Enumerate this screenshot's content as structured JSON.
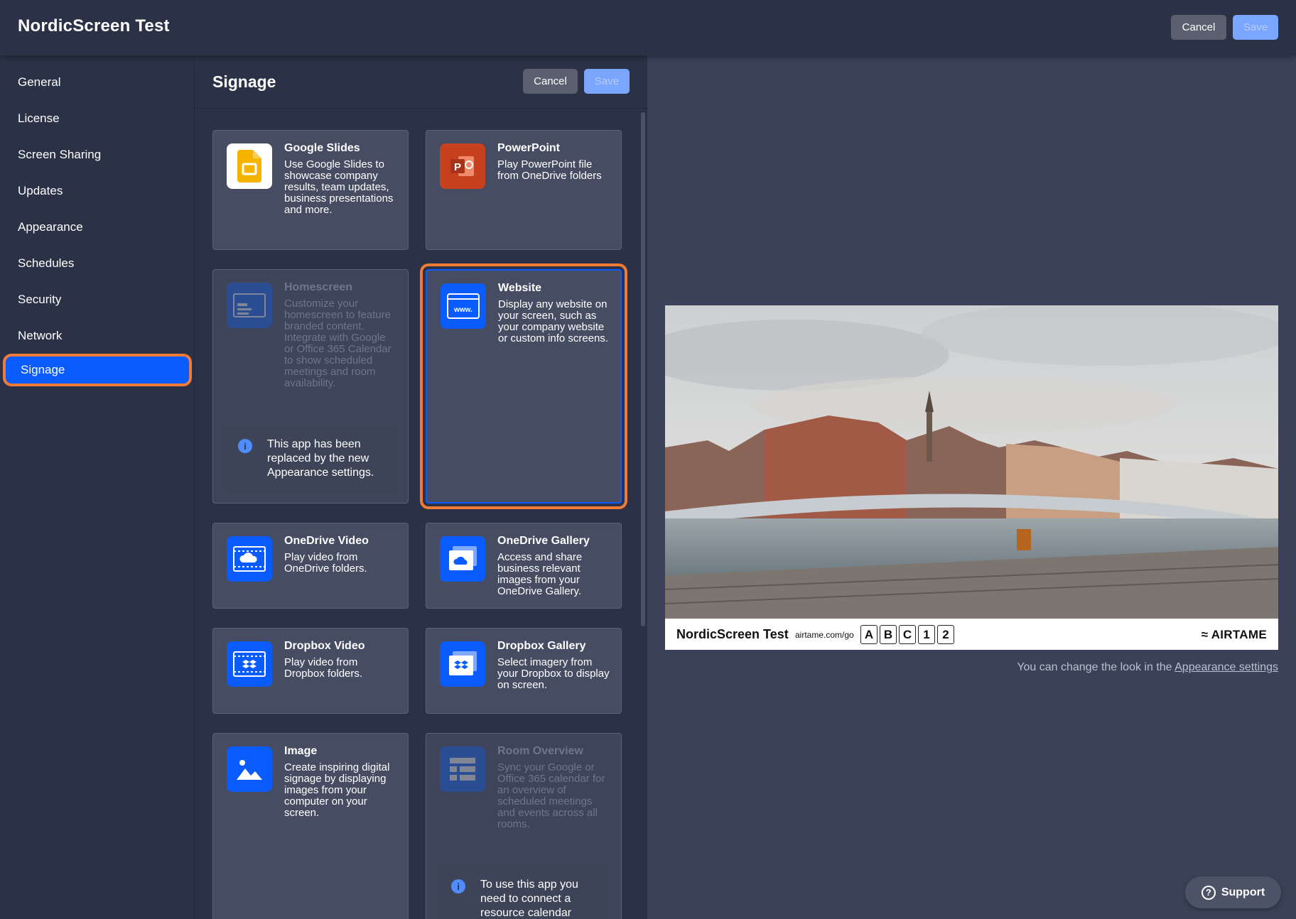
{
  "header": {
    "title": "NordicScreen Test",
    "cancel_label": "Cancel",
    "save_label": "Save"
  },
  "sidebar": {
    "items": [
      {
        "label": "General"
      },
      {
        "label": "License"
      },
      {
        "label": "Screen Sharing"
      },
      {
        "label": "Updates"
      },
      {
        "label": "Appearance"
      },
      {
        "label": "Schedules"
      },
      {
        "label": "Security"
      },
      {
        "label": "Network"
      },
      {
        "label": "Signage",
        "active": true
      }
    ]
  },
  "panel": {
    "title": "Signage",
    "cancel_label": "Cancel",
    "save_label": "Save",
    "apps": [
      {
        "title": "Google Slides",
        "desc": "Use Google Slides to showcase company results, team updates, business presentations and more.",
        "icon": "google-slides-icon"
      },
      {
        "title": "PowerPoint",
        "desc": "Play PowerPoint file from OneDrive folders",
        "icon": "powerpoint-icon"
      },
      {
        "title": "Homescreen",
        "desc": "Customize your homescreen to feature branded content. Integrate with Google or Office 365 Calendar to show scheduled meetings and room availability.",
        "icon": "homescreen-icon",
        "disabled": true,
        "notice": "This app has been replaced by the new Appearance settings."
      },
      {
        "title": "Website",
        "desc": "Display any website on your screen, such as your company website or custom info screens.",
        "icon": "website-icon",
        "selected": true
      },
      {
        "title": "OneDrive Video",
        "desc": "Play video from OneDrive folders.",
        "icon": "onedrive-video-icon"
      },
      {
        "title": "OneDrive Gallery",
        "desc": "Access and share business relevant images from your OneDrive Gallery.",
        "icon": "onedrive-gallery-icon"
      },
      {
        "title": "Dropbox Video",
        "desc": "Play video from Dropbox folders.",
        "icon": "dropbox-video-icon"
      },
      {
        "title": "Dropbox Gallery",
        "desc": "Select imagery from your Dropbox to display on screen.",
        "icon": "dropbox-gallery-icon"
      },
      {
        "title": "Image",
        "desc": "Create inspiring digital signage by displaying images from your computer on your screen.",
        "icon": "image-icon"
      },
      {
        "title": "Room Overview",
        "desc": "Sync your Google or Office 365 calendar for an overview of scheduled meetings and events across all rooms.",
        "icon": "room-overview-icon",
        "disabled": true,
        "notice": "To use this app you need to connect a resource calendar"
      }
    ]
  },
  "preview": {
    "name": "NordicScreen Test",
    "url": "airtame.com/go",
    "code": [
      "A",
      "B",
      "C",
      "1",
      "2"
    ],
    "logo": "≈ AIRTAME",
    "hint_prefix": "You can change the look in the",
    "hint_link": "Appearance settings"
  },
  "support": {
    "label": "Support"
  },
  "colors": {
    "accent": "#0a5cff",
    "highlight": "#f07a38",
    "panel": "#2b3146",
    "background": "#3a4158"
  }
}
